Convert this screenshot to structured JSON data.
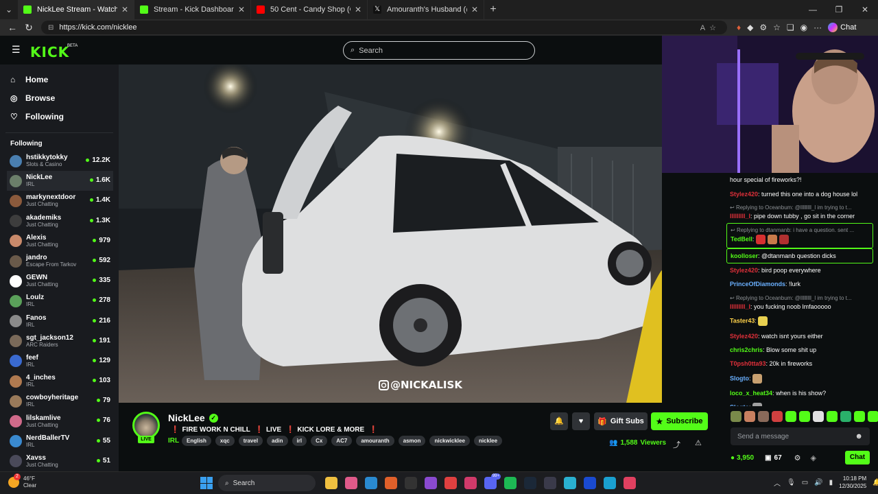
{
  "browser": {
    "tabs": [
      {
        "title": "NickLee Stream - Watch Live on",
        "color": "#53fc18",
        "active": true
      },
      {
        "title": "Stream - Kick Dashboard",
        "color": "#53fc18",
        "active": false
      },
      {
        "title": "50 Cent - Candy Shop (Official Mu",
        "color": "#ff0000",
        "active": false
      },
      {
        "title": "Amouranth's Husband (@nickwick",
        "color": "#111111",
        "active": false
      }
    ],
    "url": "https://kick.com/nicklee",
    "chat_label": "Chat"
  },
  "header": {
    "logo": "KICK",
    "beta": "BETA",
    "search_placeholder": "Search"
  },
  "nav": {
    "items": [
      {
        "label": "Home",
        "icon": "home-icon"
      },
      {
        "label": "Browse",
        "icon": "compass-icon"
      },
      {
        "label": "Following",
        "icon": "heart-icon"
      }
    ],
    "following_heading": "Following"
  },
  "following": [
    {
      "name": "hstikkytokky",
      "category": "Slots & Casino",
      "viewers": "12.2K",
      "color": "#4a7fb0"
    },
    {
      "name": "NickLee",
      "category": "IRL",
      "viewers": "1.6K",
      "color": "#6b7f6a",
      "selected": true
    },
    {
      "name": "markynextdoor",
      "category": "Just Chatting",
      "viewers": "1.4K",
      "color": "#8b5a3c"
    },
    {
      "name": "akademiks",
      "category": "Just Chatting",
      "viewers": "1.3K",
      "color": "#3d3d3d"
    },
    {
      "name": "Alexis",
      "category": "Just Chatting",
      "viewers": "979",
      "color": "#c98a6b"
    },
    {
      "name": "jandro",
      "category": "Escape From Tarkov",
      "viewers": "592",
      "color": "#6a5a4a"
    },
    {
      "name": "GEWN",
      "category": "Just Chatting",
      "viewers": "335",
      "color": "#ffffff"
    },
    {
      "name": "Loulz",
      "category": "IRL",
      "viewers": "278",
      "color": "#5aa05a"
    },
    {
      "name": "Fanos",
      "category": "IRL",
      "viewers": "216",
      "color": "#8a8a8a"
    },
    {
      "name": "sgt_jackson12",
      "category": "ARC Raiders",
      "viewers": "191",
      "color": "#7a6a5a"
    },
    {
      "name": "feef",
      "category": "IRL",
      "viewers": "129",
      "color": "#3a6ad0"
    },
    {
      "name": "4_inches",
      "category": "IRL",
      "viewers": "103",
      "color": "#b07a50"
    },
    {
      "name": "cowboyheritage",
      "category": "IRL",
      "viewers": "79",
      "color": "#9a7a5a"
    },
    {
      "name": "lilskamlive",
      "category": "Just Chatting",
      "viewers": "76",
      "color": "#d06a8a"
    },
    {
      "name": "NerdBallerTV",
      "category": "IRL",
      "viewers": "55",
      "color": "#3a8ad0"
    },
    {
      "name": "Xavss",
      "category": "Just Chatting",
      "viewers": "51",
      "color": "#4a4a5a"
    }
  ],
  "video": {
    "overlay_handle": "@NICKALISK"
  },
  "stream": {
    "name": "NickLee",
    "live_badge": "LIVE",
    "title_parts": [
      "FIRE WORK N CHILL",
      "LIVE",
      "KICK LORE & MORE"
    ],
    "category": "IRL",
    "tags": [
      "English",
      "xqc",
      "travel",
      "adin",
      "irl",
      "Cx",
      "AC7",
      "amouranth",
      "asmon",
      "nickwicklee",
      "nicklee"
    ],
    "gift_label": "Gift Subs",
    "subscribe_label": "Subscribe",
    "viewers": "1,588",
    "viewers_label": "Viewers"
  },
  "chat": {
    "messages": [
      {
        "user": "",
        "user_color": "#ffffff",
        "text": "hour special of fireworks?!"
      },
      {
        "user": "Stylez420",
        "user_color": "#e0303a",
        "text": "turned this one into a dog house lol"
      },
      {
        "reply": "Replying to Oceanbum: @lllllllll_l im trying to t...",
        "user": "lllllllll_l",
        "user_color": "#e0303a",
        "text": "pipe down tubby , go sit in the corner"
      },
      {
        "reply": "Replying to dtanmanb: i have a question. sent ...",
        "user": "TedBell",
        "user_color": "#53fc18",
        "text": "",
        "emotes": [
          "#d63030",
          "#c87a4a",
          "#b03030"
        ],
        "highlight": true
      },
      {
        "user": "koolloser",
        "user_color": "#53fc18",
        "text": "@dtanmanb question dicks",
        "highlight": true
      },
      {
        "user": "Stylez420",
        "user_color": "#e0303a",
        "text": "bird poop everywhere"
      },
      {
        "user": "PrinceOfDiamonds",
        "user_color": "#6ab0ff",
        "text": "!lurk"
      },
      {
        "reply": "Replying to Oceanbum: @lllllllll_l im trying to t...",
        "user": "lllllllll_l",
        "user_color": "#e0303a",
        "text": "you fucking noob lmfaooooo"
      },
      {
        "user": "Taster43",
        "user_color": "#ffd24a",
        "text": "",
        "emotes": [
          "#e8d050"
        ]
      },
      {
        "user": "Stylez420",
        "user_color": "#e0303a",
        "text": "watch isnt yours either"
      },
      {
        "user": "chris2chris",
        "user_color": "#53fc18",
        "text": "Blow some shit up"
      },
      {
        "user": "T0psh0tta93",
        "user_color": "#e0303a",
        "text": "20k in fireworks"
      },
      {
        "user": "Slogto",
        "user_color": "#6ab0ff",
        "text": "",
        "emotes": [
          "#c8a070"
        ]
      },
      {
        "user": "loco_x_heat34",
        "user_color": "#53fc18",
        "text": "when is his show?"
      },
      {
        "user": "Slogto",
        "user_color": "#6ab0ff",
        "text": "",
        "emotes": [
          "#a0a0a0"
        ]
      }
    ],
    "emote_bar": [
      "#7a8a4a",
      "#c88060",
      "#8a6a5a",
      "#d04040",
      "#53fc18",
      "#53fc18",
      "#e0e0e0",
      "#53fc18",
      "#2ab06a",
      "#53fc18",
      "#53fc18"
    ],
    "input_placeholder": "Send a message",
    "points": "3,950",
    "balance": "67",
    "send_label": "Chat"
  },
  "taskbar": {
    "temp": "46°F",
    "condition": "Clear",
    "notif_count": "2",
    "search_label": "Search",
    "time": "10:18 PM",
    "date": "12/30/2025",
    "apps": [
      "#f0c040",
      "#e05a8a",
      "#2a8ad0",
      "#e0602a",
      "#333333",
      "#8a4ad0",
      "#e04040",
      "#d03a6a",
      "#5865f2",
      "#1db954",
      "#1b2838",
      "#3a3a4a",
      "#2ab0d0",
      "#1a4ad0",
      "#1aa0d0",
      "#e04060"
    ],
    "apps_badge": "99+"
  }
}
